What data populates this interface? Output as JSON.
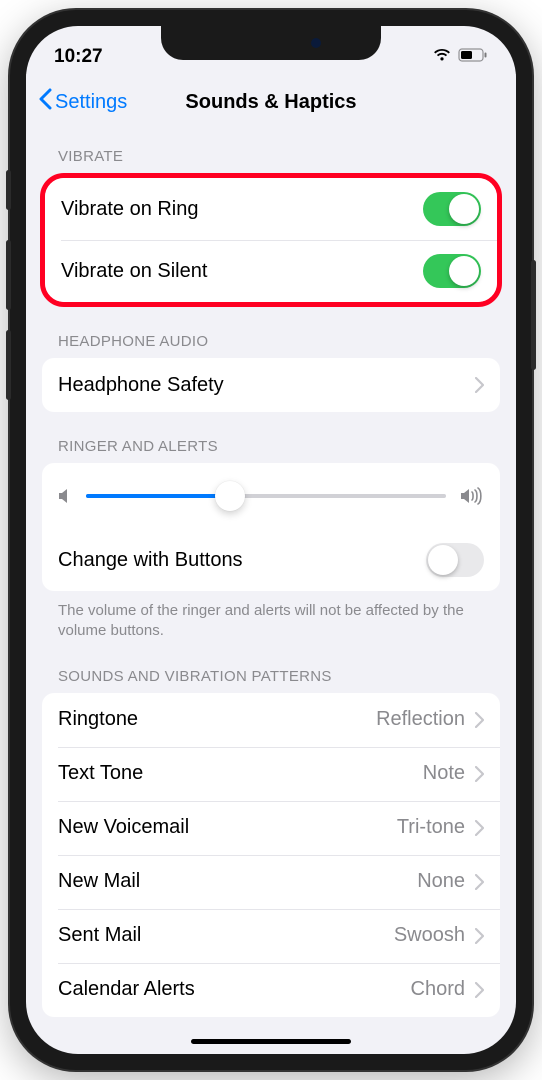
{
  "status": {
    "time": "10:27"
  },
  "nav": {
    "back": "Settings",
    "title": "Sounds & Haptics"
  },
  "sections": {
    "vibrate": {
      "header": "VIBRATE",
      "items": [
        {
          "label": "Vibrate on Ring",
          "toggle": true
        },
        {
          "label": "Vibrate on Silent",
          "toggle": true
        }
      ]
    },
    "headphone": {
      "header": "HEADPHONE AUDIO",
      "items": [
        {
          "label": "Headphone Safety"
        }
      ]
    },
    "ringer": {
      "header": "RINGER AND ALERTS",
      "slider_value": 40,
      "change_buttons": {
        "label": "Change with Buttons",
        "toggle": false
      },
      "footer": "The volume of the ringer and alerts will not be affected by the volume buttons."
    },
    "patterns": {
      "header": "SOUNDS AND VIBRATION PATTERNS",
      "items": [
        {
          "label": "Ringtone",
          "value": "Reflection"
        },
        {
          "label": "Text Tone",
          "value": "Note"
        },
        {
          "label": "New Voicemail",
          "value": "Tri-tone"
        },
        {
          "label": "New Mail",
          "value": "None"
        },
        {
          "label": "Sent Mail",
          "value": "Swoosh"
        },
        {
          "label": "Calendar Alerts",
          "value": "Chord"
        }
      ]
    }
  }
}
